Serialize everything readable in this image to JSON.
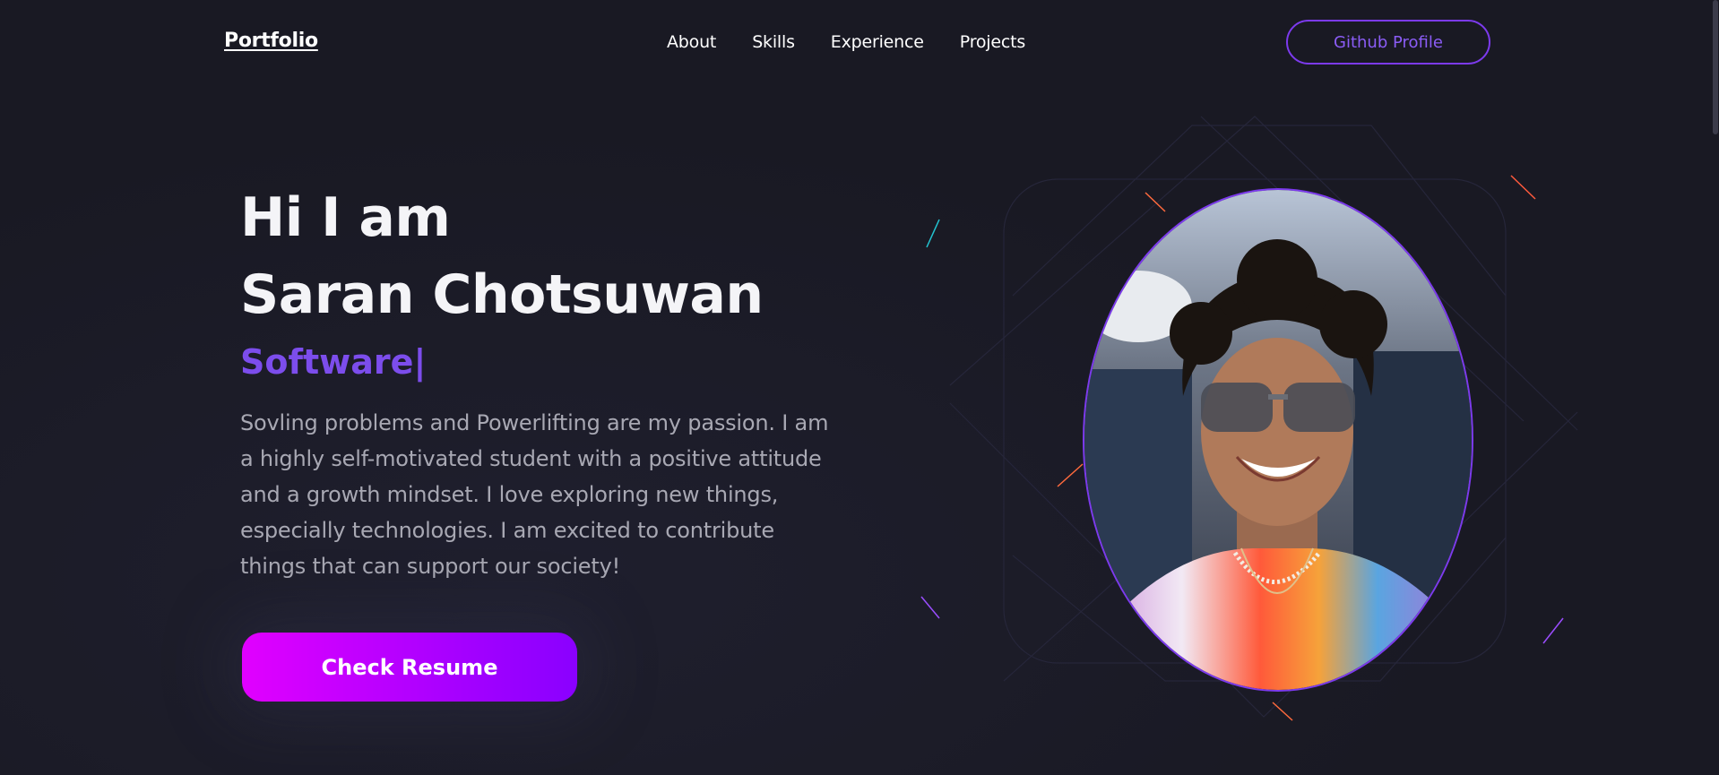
{
  "nav": {
    "logo": "Portfolio",
    "links": [
      "About",
      "Skills",
      "Experience",
      "Projects"
    ],
    "github_button": "Github Profile"
  },
  "hero": {
    "greeting": "Hi I am",
    "name": "Saran Chotsuwan",
    "role": "Software",
    "caret": "|",
    "description": "Sovling problems and Powerlifting are my passion. I am a highly self-motivated student with a positive attitude and a growth mindset. I love exploring new things, especially technologies. I am excited to contribute things that can support our society!",
    "resume_button": "Check Resume"
  },
  "colors": {
    "background": "#191923",
    "accent": "#7c3aed",
    "button_gradient_start": "#e100ff",
    "button_gradient_end": "#8a00ff",
    "text_muted": "#a8a8b3"
  }
}
